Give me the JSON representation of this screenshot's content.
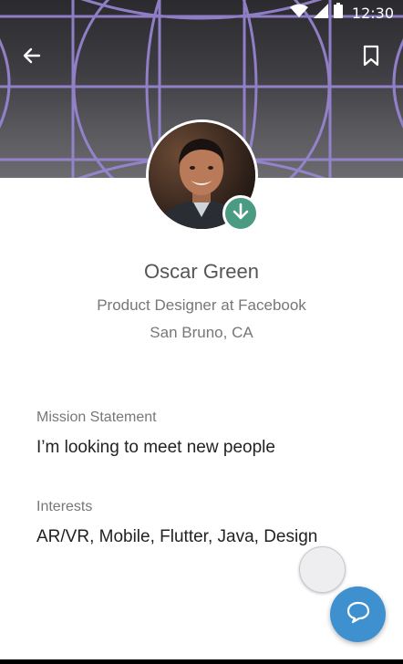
{
  "status_bar": {
    "time": "12:30",
    "icons": [
      "wifi-icon",
      "signal-icon",
      "battery-icon"
    ]
  },
  "header": {
    "back_icon": "arrow-left-icon",
    "bookmark_icon": "bookmark-icon",
    "colors": {
      "pattern": "#9a87d6",
      "background": "#3d3d42"
    }
  },
  "profile": {
    "name": "Oscar Green",
    "title": "Product Designer at Facebook",
    "location": "San Bruno, CA",
    "badge_icon": "arrow-down-icon",
    "badge_color": "#4a9b82"
  },
  "sections": {
    "mission": {
      "label": "Mission Statement",
      "value": "I’m looking to meet new people"
    },
    "interests": {
      "label": "Interests",
      "value": "AR/VR, Mobile, Flutter, Java, Design"
    }
  },
  "fab": {
    "icon": "chat-bubble-icon",
    "color": "#3e90cf"
  }
}
